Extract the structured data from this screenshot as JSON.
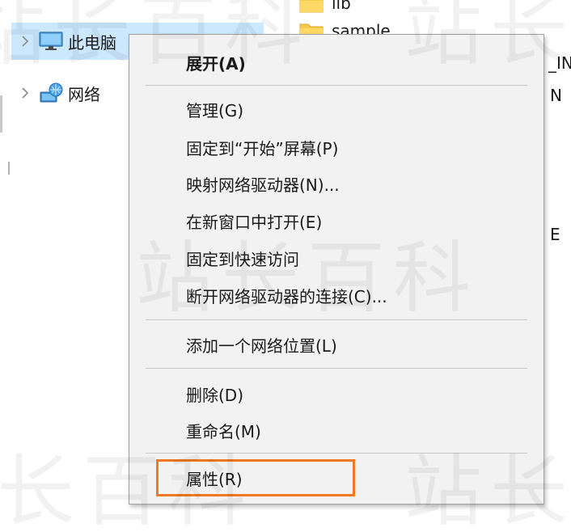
{
  "nav_pane": {
    "items": [
      {
        "label": "此电脑",
        "icon": "computer-icon",
        "selected": true
      },
      {
        "label": "网络",
        "icon": "network-icon",
        "selected": false
      }
    ]
  },
  "content_pane": {
    "folders": [
      {
        "label": "lib",
        "icon": "folder-icon"
      },
      {
        "label": "sample",
        "icon": "folder-icon"
      }
    ],
    "edge_texts": [
      "_IN",
      "N",
      "E"
    ]
  },
  "context_menu": {
    "items": [
      {
        "label": "展开(A)",
        "bold": true
      },
      {
        "label": "管理(G)"
      },
      {
        "label": "固定到“开始”屏幕(P)"
      },
      {
        "label": "映射网络驱动器(N)..."
      },
      {
        "label": "在新窗口中打开(E)"
      },
      {
        "label": "固定到快速访问"
      },
      {
        "label": "断开网络驱动器的连接(C)..."
      },
      {
        "label": "添加一个网络位置(L)"
      },
      {
        "label": "删除(D)"
      },
      {
        "label": "重命名(M)"
      },
      {
        "label": "属性(R)",
        "highlighted": true
      }
    ]
  },
  "watermark": {
    "text": "站长百科"
  },
  "colors": {
    "selection": "#cce8ff",
    "menu_background": "#f2f2f2",
    "highlight_outline": "#f07820"
  }
}
